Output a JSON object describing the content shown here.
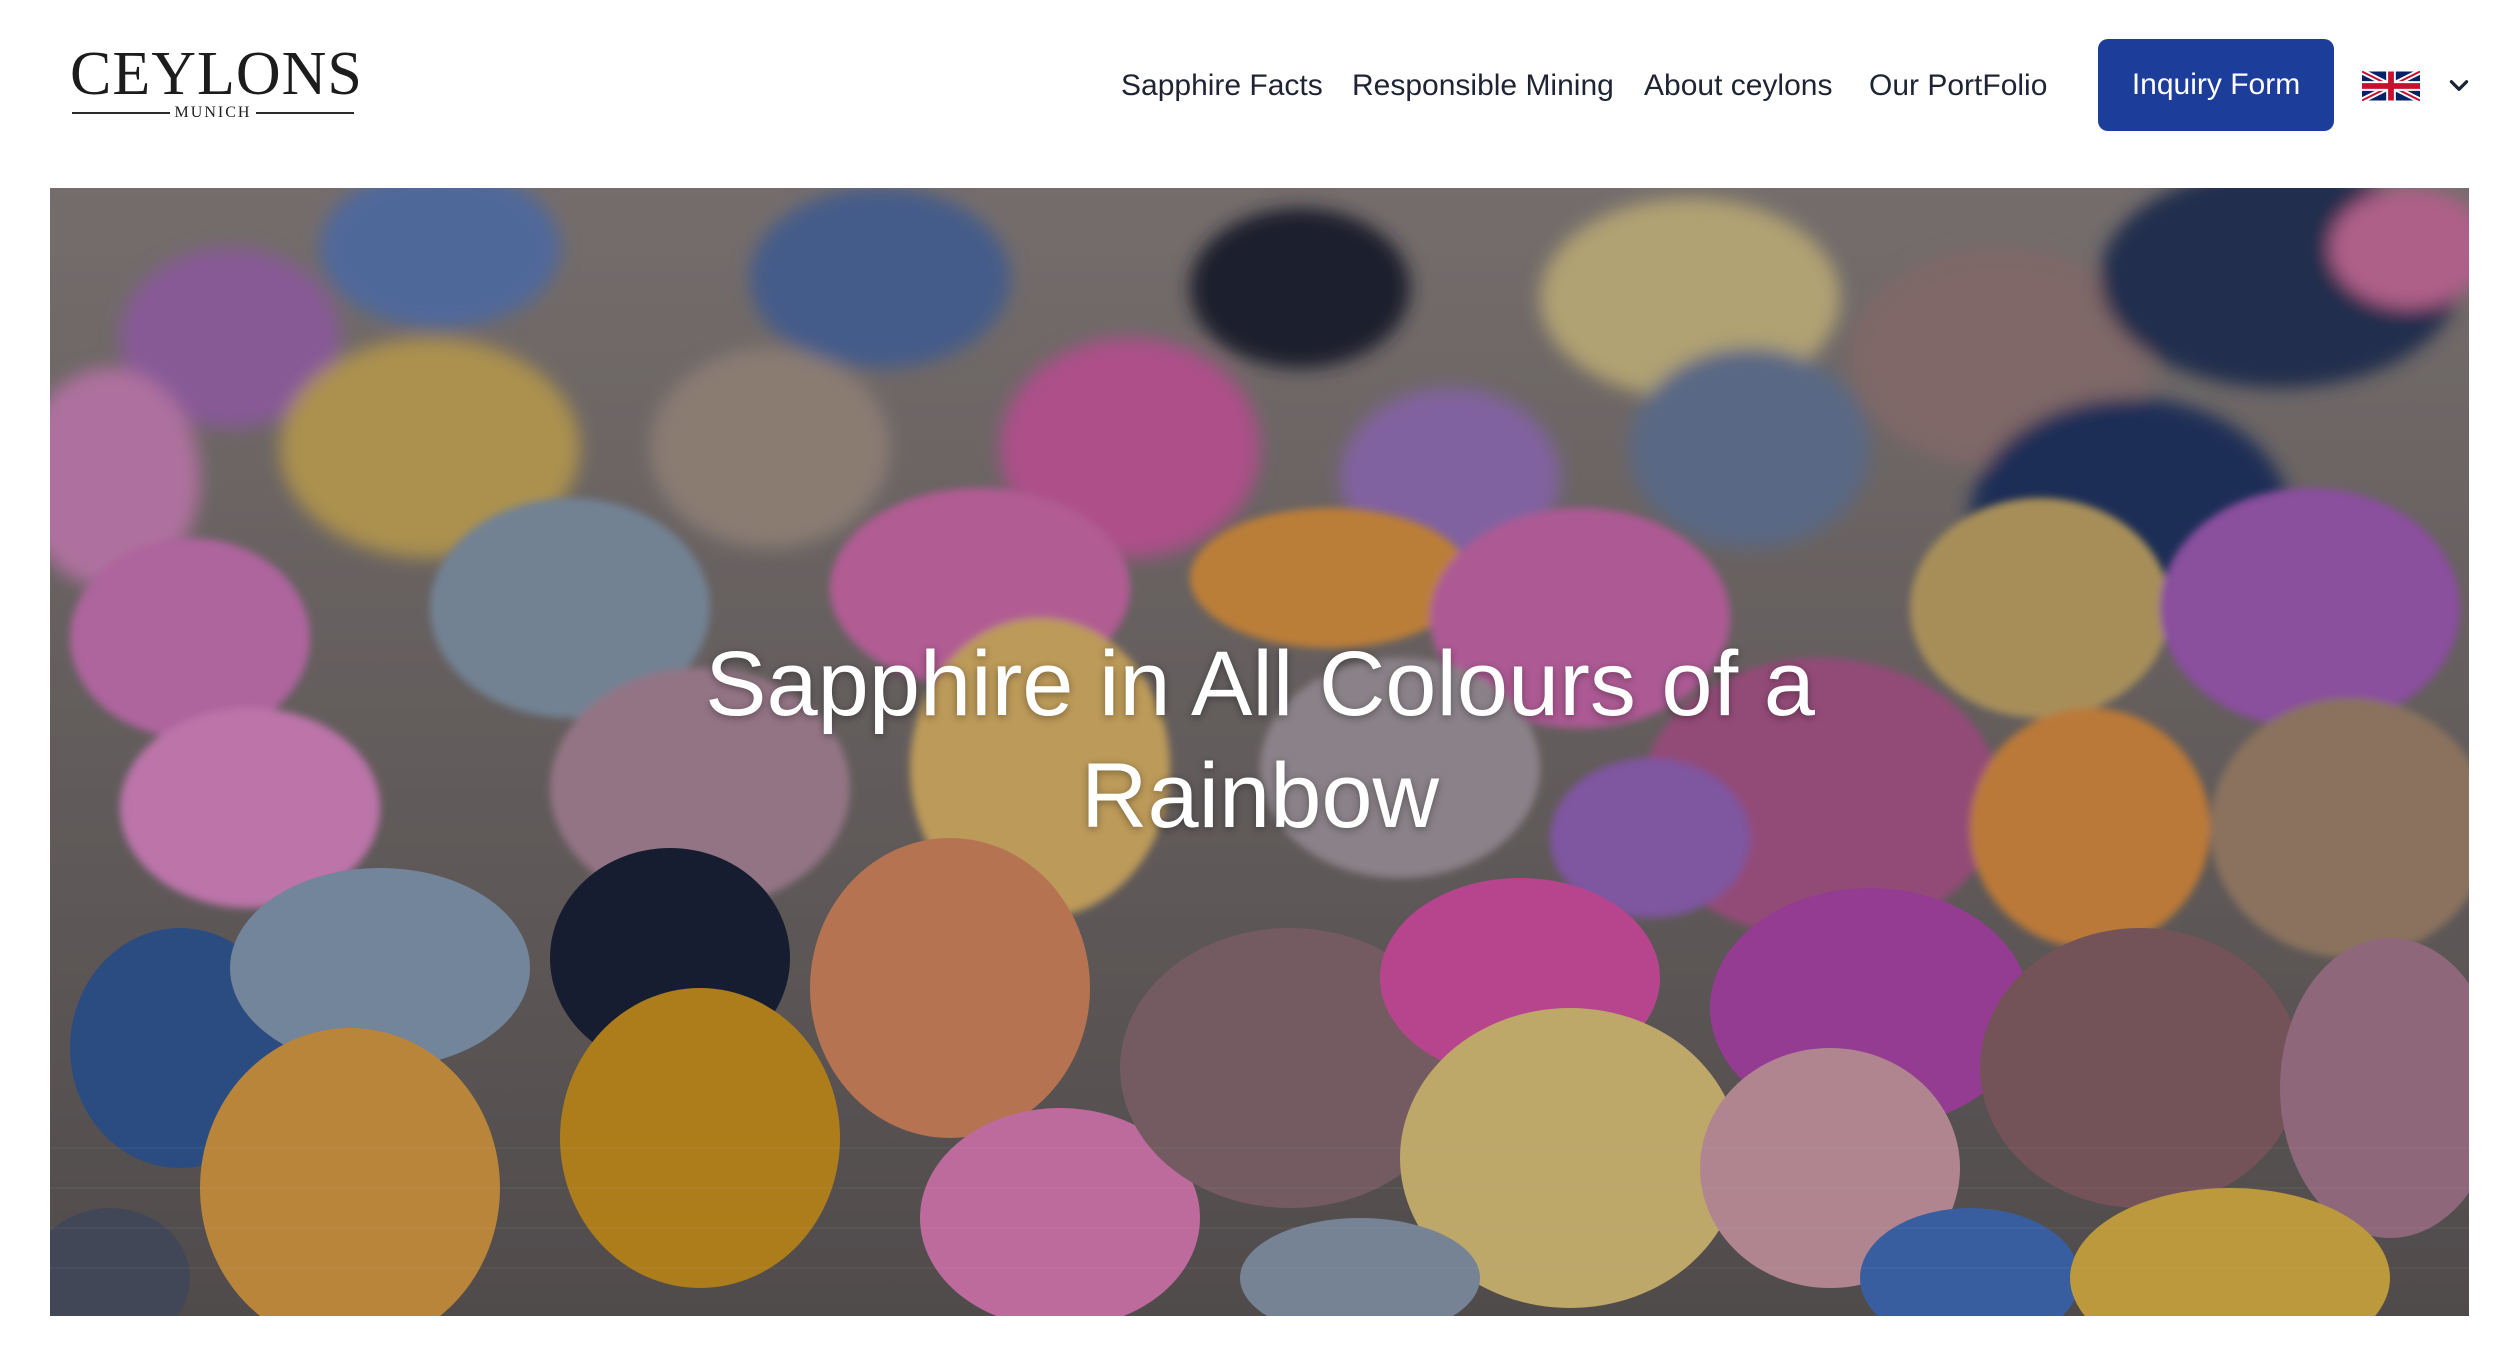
{
  "brand": {
    "name": "CEYLONS",
    "sub": "MUNICH"
  },
  "nav": {
    "items": [
      {
        "label": "Sapphire Facts"
      },
      {
        "label": "Responsible Mining"
      },
      {
        "label": "About ceylons"
      },
      {
        "label": "Our PortFolio"
      }
    ],
    "cta_label": "Inquiry Form",
    "language_icon": "uk-flag-icon",
    "dropdown_icon": "chevron-down-icon"
  },
  "hero": {
    "title": "Sapphire in All Colours of a Rainbow",
    "background": "multicoloured rough sapphires photo"
  },
  "colors": {
    "accent": "#1d3d9b",
    "text": "#1f2433",
    "hero_text": "#ffffff"
  }
}
